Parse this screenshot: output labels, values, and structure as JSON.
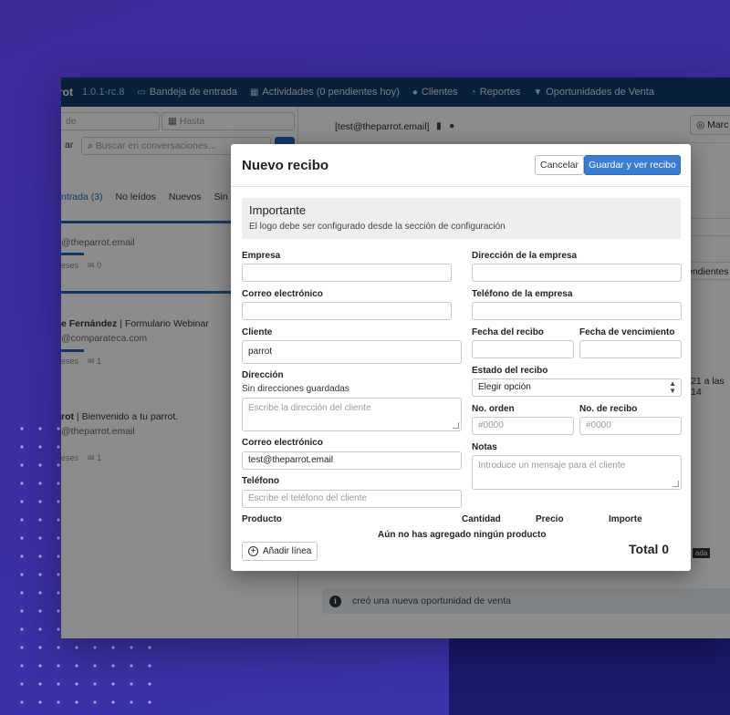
{
  "background": {
    "accent": "#3d2b9c",
    "navy": "#1a1a6b"
  },
  "topnav": {
    "brand": "rot",
    "version": "1.0.1-rc.8",
    "items": [
      {
        "icon": "inbox-icon",
        "label": "Bandeja de entrada"
      },
      {
        "icon": "calendar-icon",
        "label": "Actividades (0 pendientes hoy)"
      },
      {
        "icon": "users-icon",
        "label": "Clientes"
      },
      {
        "icon": "chart-icon",
        "label": "Reportes"
      },
      {
        "icon": "funnel-icon",
        "label": "Oportunidades de Venta"
      }
    ]
  },
  "left": {
    "date_from_placeholder": "de",
    "date_to_placeholder": "Hasta",
    "filter_button": "ar",
    "search_placeholder": "Buscar en conversaciones...",
    "tabs": [
      "ntrada (3)",
      "No leídos",
      "Nuevos",
      "Sin r"
    ],
    "conversations": [
      {
        "name": "",
        "channel": "",
        "email": "@theparrot.email",
        "age": "eses",
        "count": "0"
      },
      {
        "name": "e Fernández",
        "channel": "Formulario Webinar",
        "email": "@comparateca.com",
        "age": "eses",
        "count": "1"
      },
      {
        "name": "rot",
        "channel": "Bienvenido a tu parrot.",
        "email": "@theparrot.email",
        "age": "eses",
        "count": "1"
      }
    ]
  },
  "right": {
    "contact_email": "[test@theparrot.email]",
    "mark_button": "Marc",
    "pending": "endientes",
    "date_partial": "21 a las 14",
    "tag_partial": "ada",
    "activity_text": "creó una nueva oportunidad de venta"
  },
  "modal": {
    "title": "Nuevo recibo",
    "cancel_label": "Cancelar",
    "save_label": "Guardar y ver recibo",
    "alert": {
      "heading": "Importante",
      "text": "El logo debe ser configurado desde la sección de configuración"
    },
    "labels": {
      "empresa": "Empresa",
      "correo_empresa": "Correo electrónico",
      "cliente": "Cliente",
      "direccion": "Dirección",
      "sin_direcciones": "Sin direcciones guardadas",
      "correo_cliente": "Correo electrónico",
      "telefono": "Teléfono",
      "direccion_empresa": "Dirección de la empresa",
      "telefono_empresa": "Teléfono de la empresa",
      "fecha_recibo": "Fecha del recibo",
      "fecha_vencimiento": "Fecha de vencimiento",
      "estado_recibo": "Estado del recibo",
      "no_orden": "No. orden",
      "no_recibo": "No. de recibo",
      "notas": "Notas",
      "producto": "Producto",
      "cantidad": "Cantidad",
      "precio": "Precio",
      "importe": "Importe"
    },
    "values": {
      "empresa": "",
      "correo_empresa": "",
      "cliente": "parrot",
      "correo_cliente": "test@theparrot.email",
      "direccion_empresa": "",
      "telefono_empresa": "",
      "fecha_recibo": "",
      "fecha_vencimiento": "",
      "estado_recibo": "Elegir opción"
    },
    "placeholders": {
      "direccion": "Escribe la dirección del cliente",
      "telefono": "Escribe el teléfono del cliente",
      "no_orden": "#0000",
      "no_recibo": "#0000",
      "notas": "Introduce un mensaje para el cliente"
    },
    "empty_products": "Aún no has agregado ningún producto",
    "add_line_label": "Añadir línea",
    "total": "Total 0"
  }
}
